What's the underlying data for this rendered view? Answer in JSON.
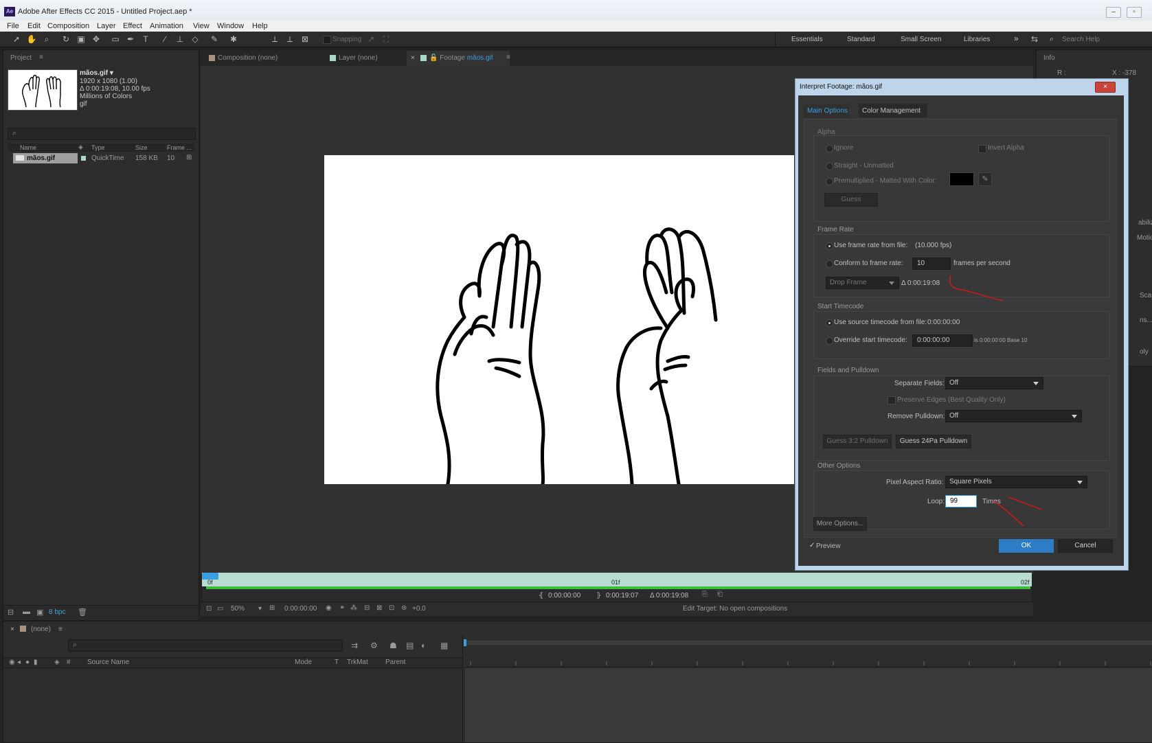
{
  "window": {
    "title": "Adobe After Effects CC 2015 - Untitled Project.aep *",
    "app_icon": "Ae"
  },
  "menu": [
    "File",
    "Edit",
    "Composition",
    "Layer",
    "Effect",
    "Animation",
    "View",
    "Window",
    "Help"
  ],
  "toolbar": {
    "snapping": "Snapping",
    "workspaces": [
      "Essentials",
      "Standard",
      "Small Screen",
      "Libraries"
    ],
    "more": "»",
    "search_help": "Search Help"
  },
  "project": {
    "tab": "Project",
    "footage_name": "mãos.gif ▾",
    "details": [
      "1920 x 1080 (1.00)",
      "Δ 0:00:19:08, 10.00 fps",
      "Millions of Colors",
      "gif"
    ],
    "columns": [
      "Name",
      "Type",
      "Size",
      "Frame ..."
    ],
    "rows": [
      {
        "name": "mãos.gif",
        "type": "QuickTime",
        "size": "158 KB",
        "frame": "10"
      }
    ],
    "bpc": "8 bpc"
  },
  "viewer_tabs": {
    "composition": "Composition (none)",
    "layer": "Layer (none)",
    "footage_prefix": "Footage",
    "footage_name": "mãos.gif"
  },
  "info_panel": {
    "tab": "Info",
    "r": "R :",
    "x": "X : -378"
  },
  "right_panel_labels": [
    "abilizer",
    "Motion",
    "Scale",
    "ns...",
    "oly"
  ],
  "dialog": {
    "title": "Interpret Footage: mãos.gif",
    "tabs": [
      "Main Options",
      "Color Management"
    ],
    "alpha": {
      "heading": "Alpha",
      "ignore": "Ignore",
      "invert": "Invert Alpha",
      "straight": "Straight - Unmatted",
      "premultiplied": "Premultiplied - Matted With Color:",
      "guess": "Guess",
      "matte_color": "#000000"
    },
    "frame_rate": {
      "heading": "Frame Rate",
      "use_file": "Use frame rate from file:",
      "file_fps": "(10.000 fps)",
      "conform": "Conform to frame rate:",
      "conform_value": "10",
      "fps_unit": "frames per second",
      "drop_frame": "Drop Frame",
      "duration": "Δ 0:00:19:08"
    },
    "start_timecode": {
      "heading": "Start Timecode",
      "use_source": "Use source timecode from file:",
      "source_value": "0:00:00:00",
      "override": "Override start timecode:",
      "override_value": "0:00:00:00",
      "equiv": "is 0:00:00:00  Base 10"
    },
    "fields": {
      "heading": "Fields and Pulldown",
      "separate_label": "Separate Fields:",
      "separate_value": "Off",
      "preserve": "Preserve Edges (Best Quality Only)",
      "remove_label": "Remove Pulldown:",
      "remove_value": "Off",
      "guess32": "Guess 3:2 Pulldown",
      "guess24": "Guess 24Pa Pulldown"
    },
    "other": {
      "heading": "Other Options",
      "par_label": "Pixel Aspect Ratio:",
      "par_value": "Square Pixels",
      "loop_label": "Loop:",
      "loop_value": "99",
      "times": "Times"
    },
    "more_options": "More Options...",
    "preview": "Preview",
    "ok": "OK",
    "cancel": "Cancel"
  },
  "viewer_timeline": {
    "start_frame": "0f",
    "mid_frame": "01f",
    "end_frame": "02f",
    "in_point": "0:00:00:00",
    "out_point": "0:00:19:07",
    "duration": "Δ 0:00:19:08"
  },
  "viewer_footer": {
    "zoom": "50%",
    "timecode": "0:00:00:00",
    "exposure": "+0.0",
    "edit_target": "Edit Target: No open compositions"
  },
  "timeline": {
    "tab": "(none)",
    "columns": [
      "Source Name",
      "Mode",
      "T",
      "TrkMat",
      "Parent"
    ]
  },
  "colors": {
    "accent": "#3a9fe0",
    "ok_button": "#2d7dc4",
    "timeline_bar": "#b9dcd0",
    "dialog_frame": "#bdd4ea",
    "annotation": "#cc1a1a"
  }
}
